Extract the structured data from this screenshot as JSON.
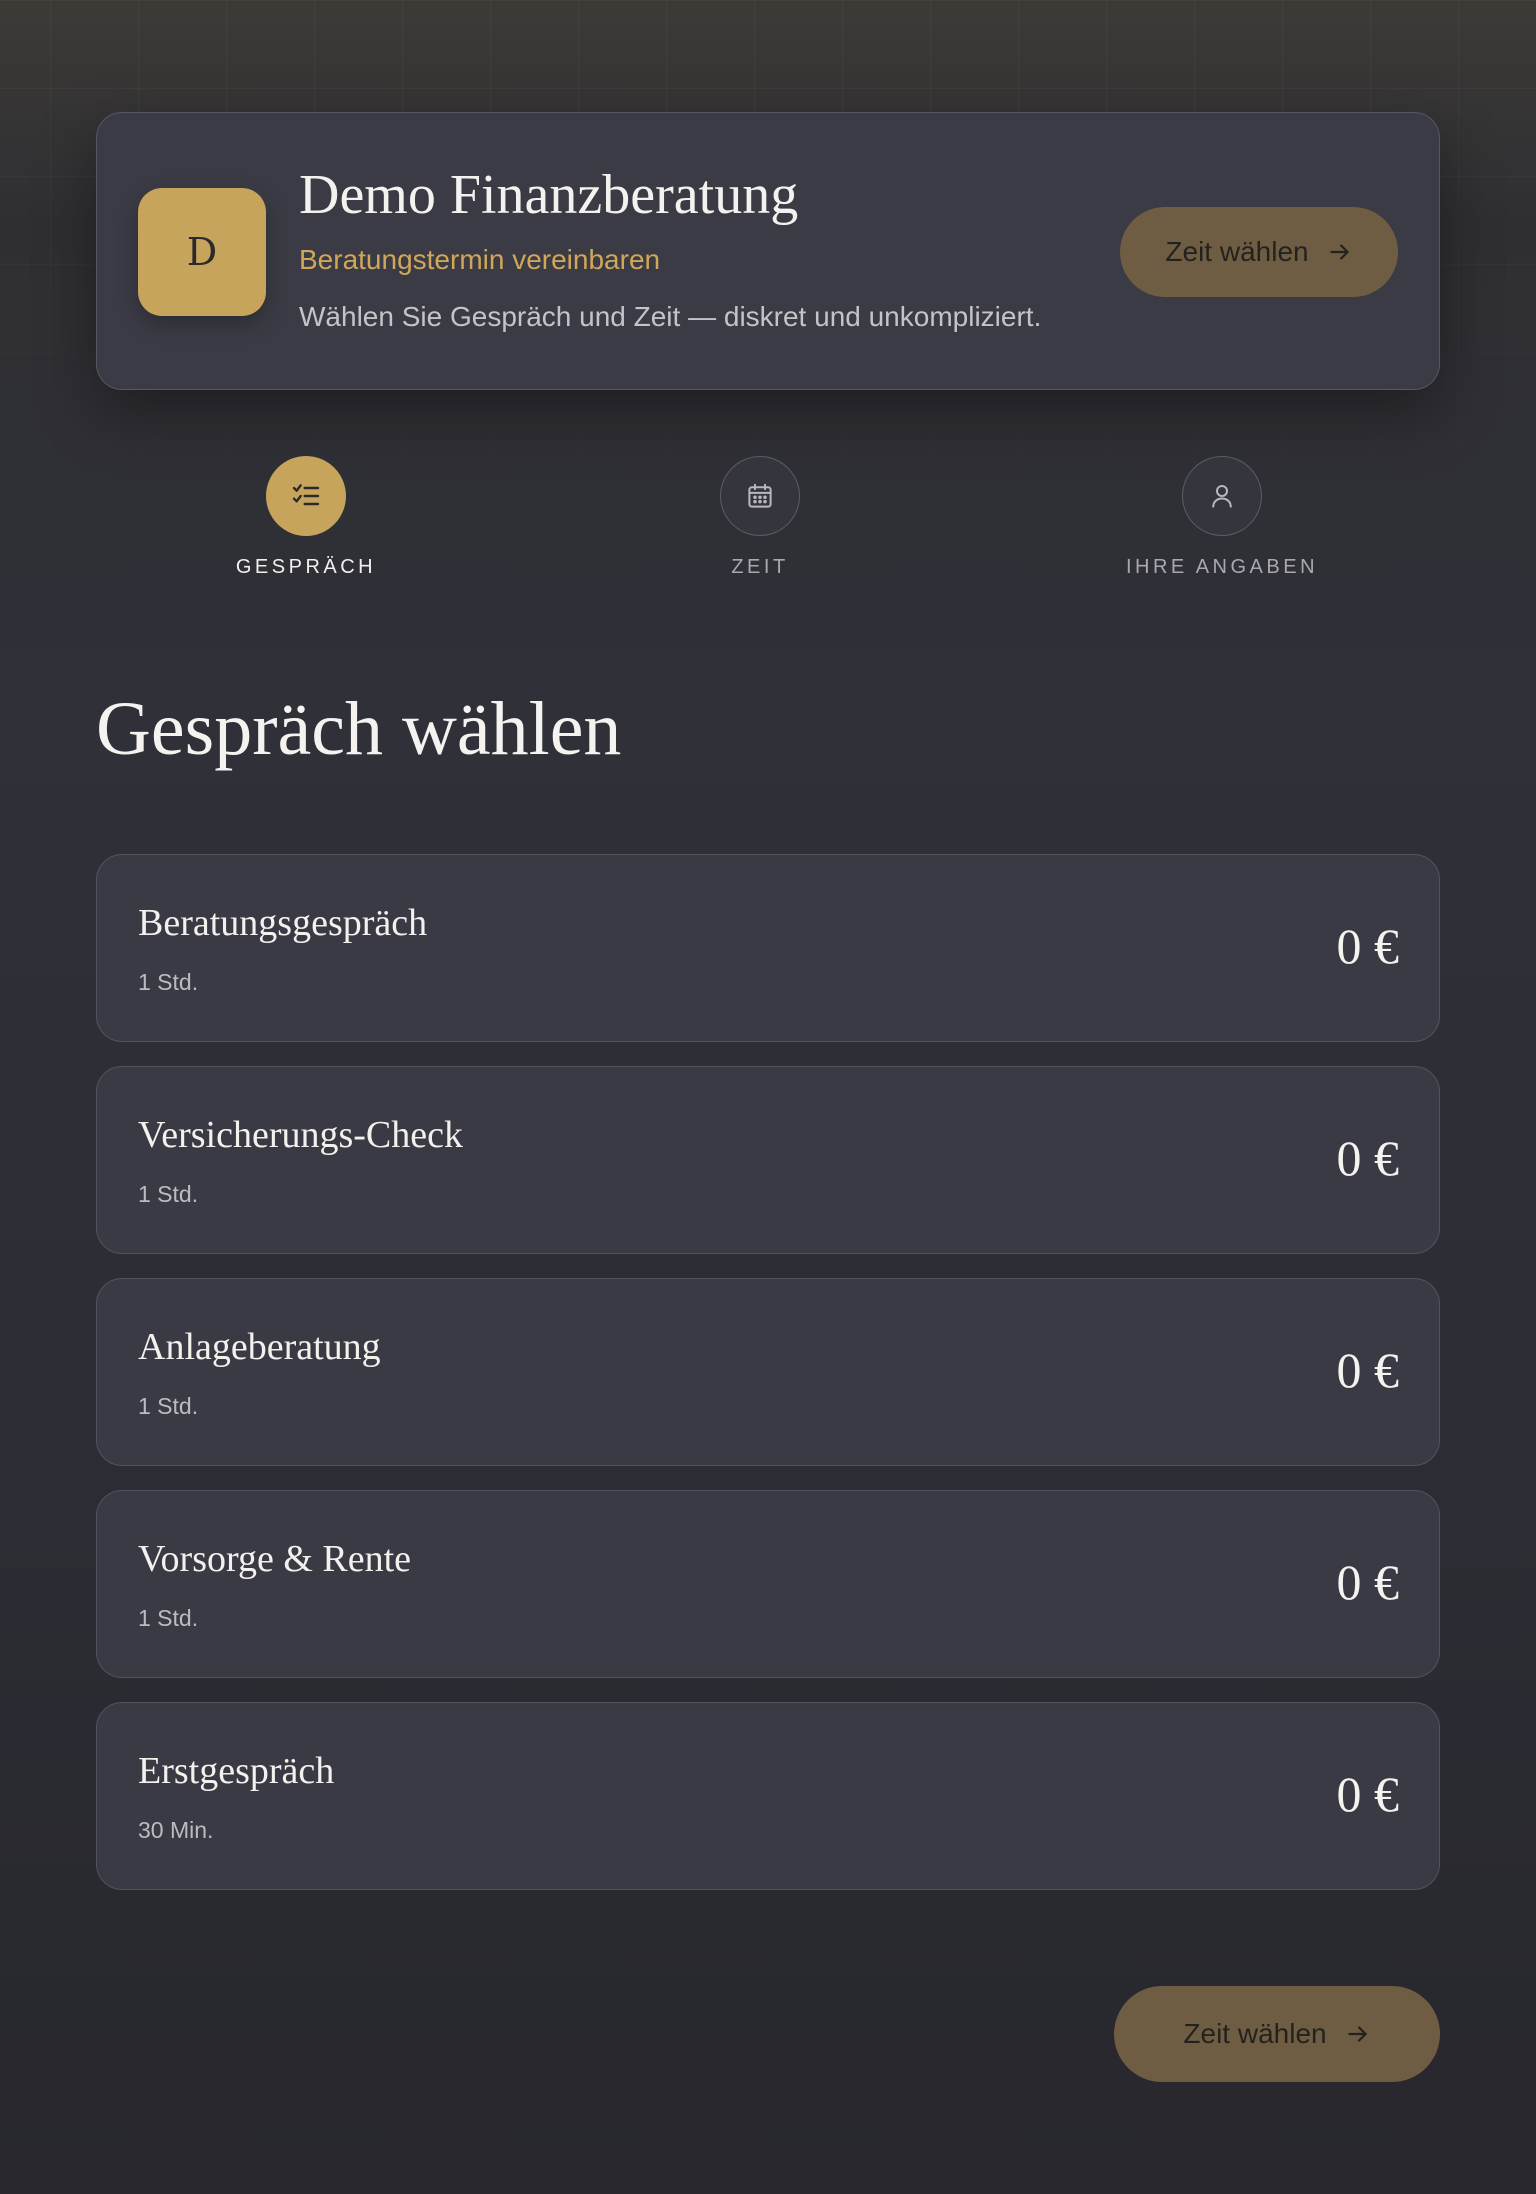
{
  "header": {
    "logo_letter": "D",
    "title": "Demo Finanzberatung",
    "subtitle": "Beratungstermin vereinbaren",
    "description": "Wählen Sie Gespräch und Zeit — diskret und unkompliziert.",
    "cta_label": "Zeit wählen"
  },
  "steps": [
    {
      "label": "GESPRÄCH",
      "icon": "checklist-icon",
      "active": true
    },
    {
      "label": "ZEIT",
      "icon": "calendar-icon",
      "active": false
    },
    {
      "label": "IHRE ANGABEN",
      "icon": "user-icon",
      "active": false
    }
  ],
  "section_title": "Gespräch wählen",
  "services": [
    {
      "name": "Beratungsgespräch",
      "duration": "1 Std.",
      "price": "0 €"
    },
    {
      "name": "Versicherungs-Check",
      "duration": "1 Std.",
      "price": "0 €"
    },
    {
      "name": "Anlageberatung",
      "duration": "1 Std.",
      "price": "0 €"
    },
    {
      "name": "Vorsorge & Rente",
      "duration": "1 Std.",
      "price": "0 €"
    },
    {
      "name": "Erstgespräch",
      "duration": "30 Min.",
      "price": "0 €"
    }
  ],
  "footer": {
    "cta_label": "Zeit wählen"
  },
  "colors": {
    "accent_gold": "#c7a45c",
    "button_gold_muted": "#6f5d43",
    "card_bg": "#393a43",
    "subtitle_gold": "#cfa65a"
  }
}
